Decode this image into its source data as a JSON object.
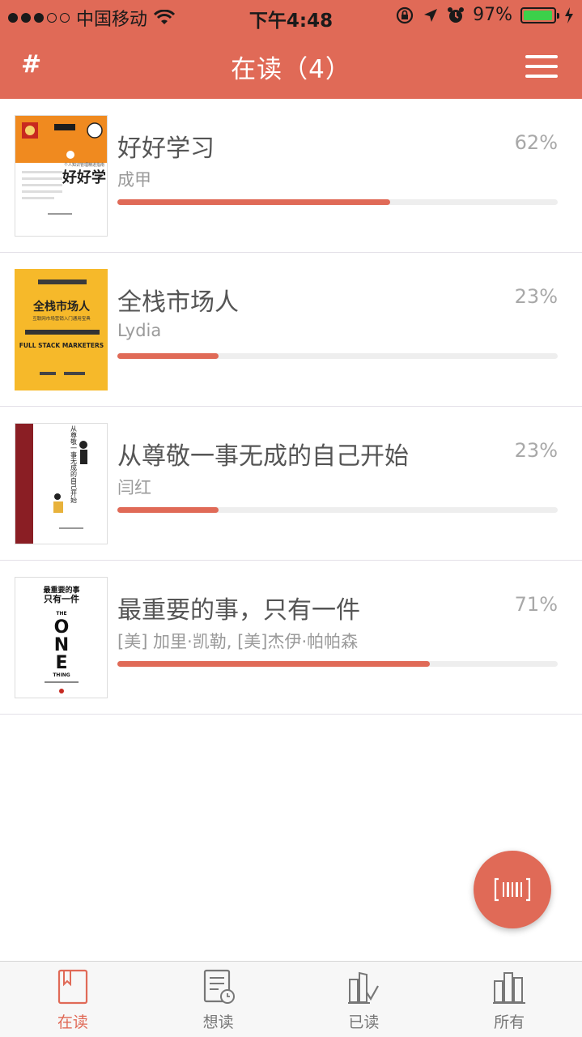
{
  "status_bar": {
    "carrier": "中国移动",
    "time": "下午4:48",
    "battery_percent": "97%",
    "battery_level": 0.97,
    "signal_bars_filled": 3,
    "signal_bars_total": 5
  },
  "header": {
    "left_label": "#",
    "title": "在读（4）",
    "menu_icon": "hamburger-menu-icon"
  },
  "colors": {
    "accent": "#e06a57",
    "progress_track": "#eeeeee",
    "text_primary": "#555555",
    "text_secondary": "#9a9a9a"
  },
  "books": [
    {
      "title": "好好学习",
      "author": "成甲",
      "percent_label": "62%",
      "progress": 0.62,
      "cover": {
        "style": "orange-white",
        "big_text": "好好学习",
        "sub_text": "个人知识管理精进指南"
      }
    },
    {
      "title": "全栈市场人",
      "author": "Lydia",
      "percent_label": "23%",
      "progress": 0.23,
      "cover": {
        "style": "yellow",
        "big_text": "全栈市场人",
        "sub_text": "互联网市场营销入门通用宝典",
        "en_text": "FULL STACK MARKETERS"
      }
    },
    {
      "title": "从尊敬一事无成的自己开始",
      "author": "闫红",
      "percent_label": "23%",
      "progress": 0.23,
      "cover": {
        "style": "white-maroon-spine",
        "big_text": "从尊敬一事无成的自己开始"
      }
    },
    {
      "title": "最重要的事，只有一件",
      "author": "[美] 加里·凯勒, [美]杰伊·帕帕森",
      "percent_label": "71%",
      "progress": 0.71,
      "cover": {
        "style": "white-black",
        "top_text": "最重要的事\n只有一件",
        "en_big": "THE ONE THING"
      }
    }
  ],
  "fab": {
    "icon": "barcode-scan-icon"
  },
  "tabs": [
    {
      "label": "在读",
      "icon": "bookmark-book-icon",
      "active": true
    },
    {
      "label": "想读",
      "icon": "list-clock-icon",
      "active": false
    },
    {
      "label": "已读",
      "icon": "books-check-icon",
      "active": false
    },
    {
      "label": "所有",
      "icon": "bookshelf-icon",
      "active": false
    }
  ]
}
